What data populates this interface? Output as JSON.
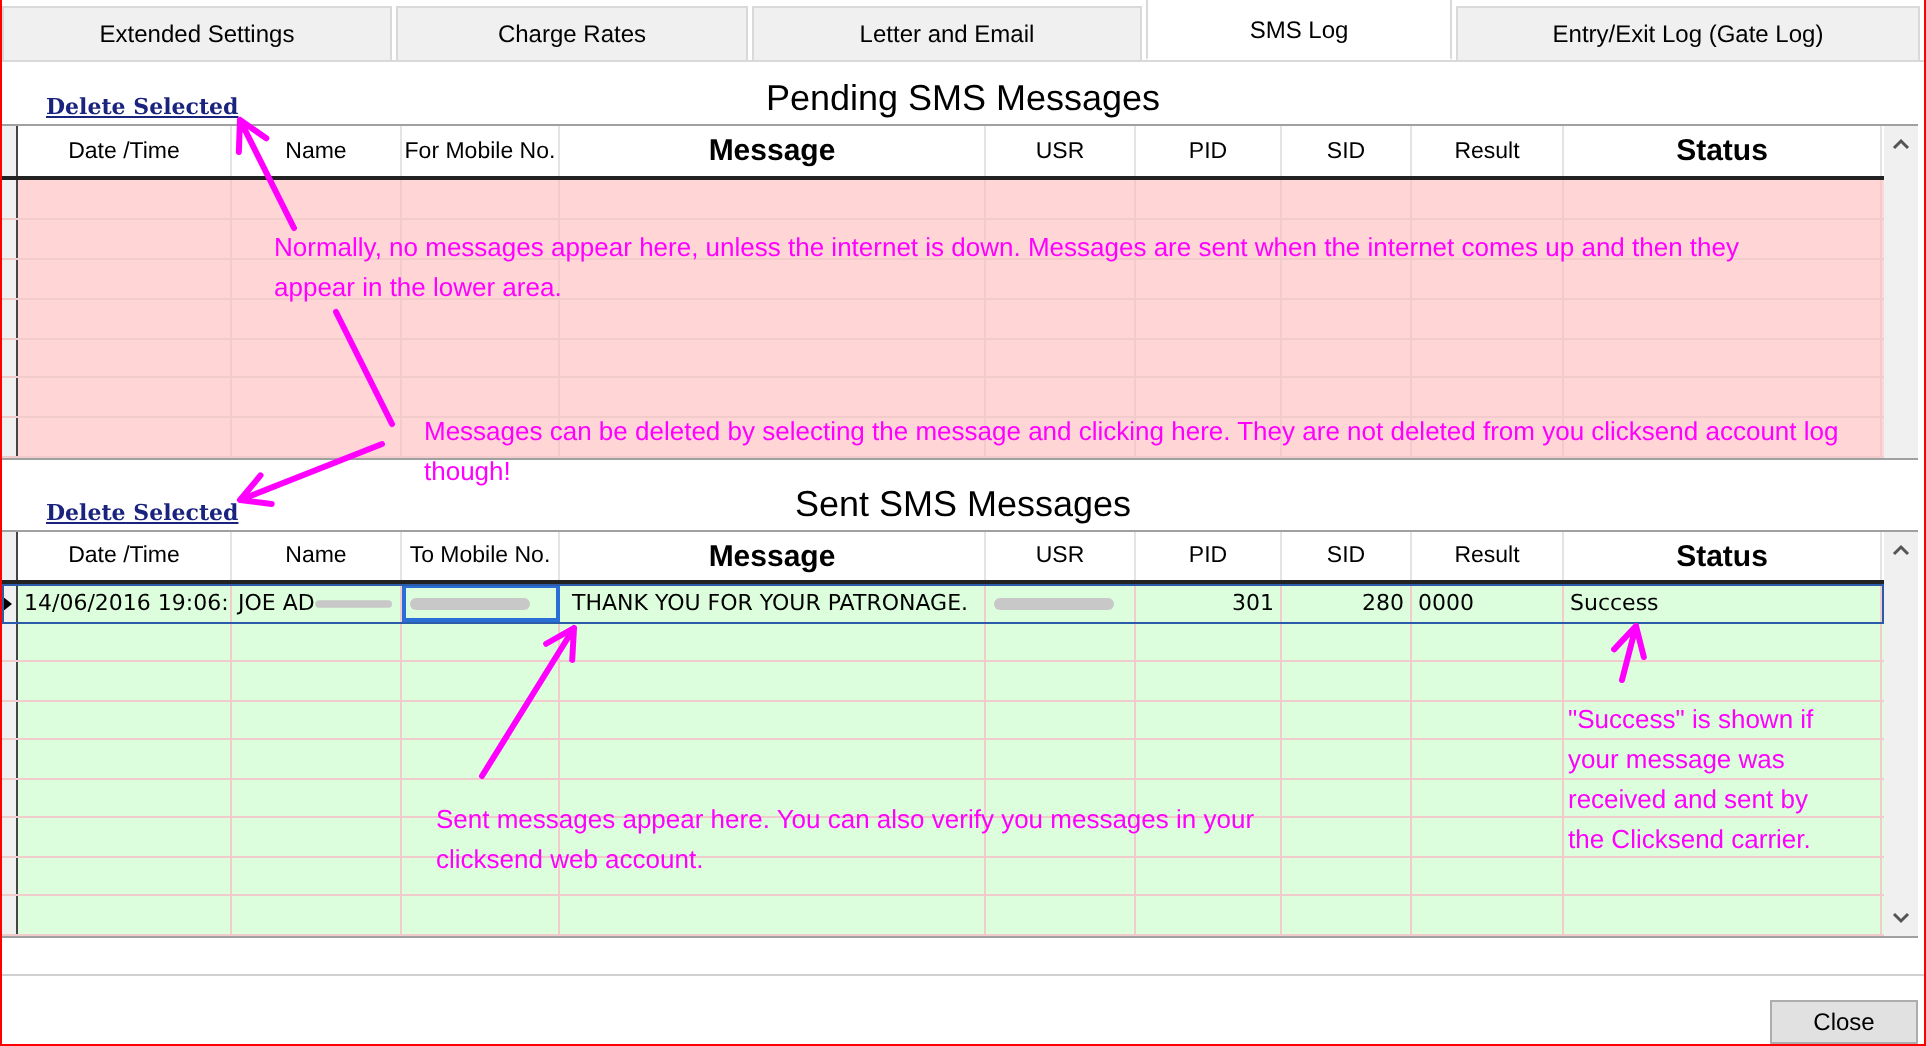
{
  "tabs": [
    {
      "label": "Extended Settings",
      "selected": false
    },
    {
      "label": "Charge Rates",
      "selected": false
    },
    {
      "label": "Letter and Email",
      "selected": false
    },
    {
      "label": "SMS Log",
      "selected": true
    },
    {
      "label": "Entry/Exit Log (Gate Log)",
      "selected": false
    }
  ],
  "pending": {
    "delete_link": "Delete Selected",
    "title": "Pending SMS Messages",
    "columns": [
      {
        "label": "Date /Time",
        "bold": false
      },
      {
        "label": "Name",
        "bold": false
      },
      {
        "label": "For Mobile No.",
        "bold": false
      },
      {
        "label": "Message",
        "bold": true
      },
      {
        "label": "USR",
        "bold": false
      },
      {
        "label": "PID",
        "bold": false
      },
      {
        "label": "SID",
        "bold": false
      },
      {
        "label": "Result",
        "bold": false
      },
      {
        "label": "Status",
        "bold": true
      }
    ]
  },
  "sent": {
    "delete_link": "Delete Selected",
    "title": "Sent SMS Messages",
    "columns": [
      {
        "label": "Date /Time",
        "bold": false
      },
      {
        "label": "Name",
        "bold": false
      },
      {
        "label": "To Mobile No.",
        "bold": false
      },
      {
        "label": "Message",
        "bold": true
      },
      {
        "label": "USR",
        "bold": false
      },
      {
        "label": "PID",
        "bold": false
      },
      {
        "label": "SID",
        "bold": false
      },
      {
        "label": "Result",
        "bold": false
      },
      {
        "label": "Status",
        "bold": true
      }
    ],
    "rows": [
      {
        "current": true,
        "date": "14/06/2016 19:06:",
        "name": "JOE AD",
        "name_blurred": true,
        "mobile_blurred": true,
        "message": "THANK YOU FOR YOUR PATRONAGE.",
        "usr_blurred": true,
        "pid": "301",
        "sid": "280",
        "result": "0000",
        "status": "Success"
      }
    ]
  },
  "annotations": [
    {
      "text": "Normally, no messages appear here, unless the internet is down. Messages are sent when the internet comes up and then they appear in the lower area."
    },
    {
      "text": "Messages can be deleted by selecting the message and clicking here. They are not deleted from you clicksend account log though!"
    },
    {
      "text": "Sent messages appear here. You can also verify you messages in your clicksend web account."
    },
    {
      "text": "\"Success\" is shown if your message was received and sent by the Clicksend carrier."
    }
  ],
  "close_button": "Close"
}
